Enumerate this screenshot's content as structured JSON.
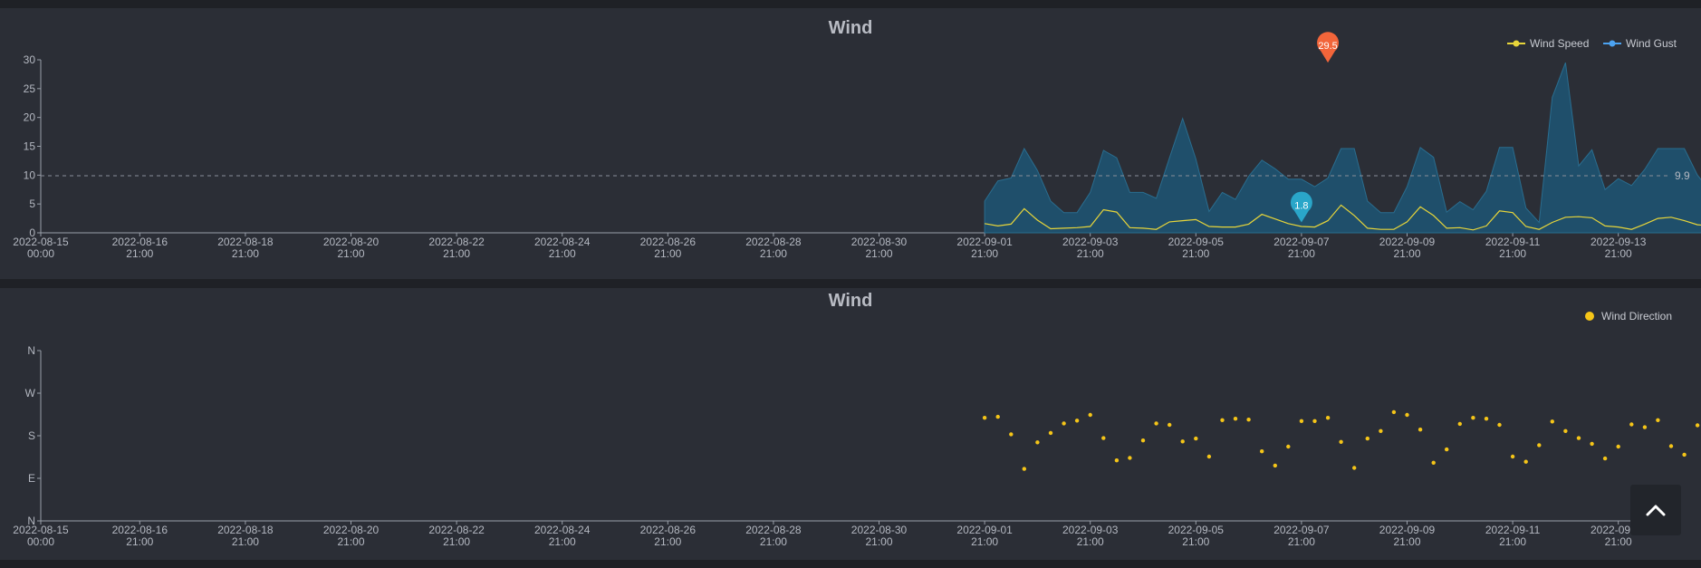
{
  "colors": {
    "panel": "#2b2e36",
    "gust_fill": "#1f4f6b",
    "speed_line": "#e7d53a",
    "direction_point": "#f5c518",
    "max_pin": "#f2653a",
    "min_pin": "#2aa6c9",
    "reference_line": "#8a8f99"
  },
  "icons": {
    "scroll_top": "chevron-up-icon"
  },
  "x_ticks": [
    {
      "line1": "2022-08-15",
      "line2": "00:00"
    },
    {
      "line1": "2022-08-16",
      "line2": "21:00"
    },
    {
      "line1": "2022-08-18",
      "line2": "21:00"
    },
    {
      "line1": "2022-08-20",
      "line2": "21:00"
    },
    {
      "line1": "2022-08-22",
      "line2": "21:00"
    },
    {
      "line1": "2022-08-24",
      "line2": "21:00"
    },
    {
      "line1": "2022-08-26",
      "line2": "21:00"
    },
    {
      "line1": "2022-08-28",
      "line2": "21:00"
    },
    {
      "line1": "2022-08-30",
      "line2": "21:00"
    },
    {
      "line1": "2022-09-01",
      "line2": "21:00"
    },
    {
      "line1": "2022-09-03",
      "line2": "21:00"
    },
    {
      "line1": "2022-09-05",
      "line2": "21:00"
    },
    {
      "line1": "2022-09-07",
      "line2": "21:00"
    },
    {
      "line1": "2022-09-09",
      "line2": "21:00"
    },
    {
      "line1": "2022-09-11",
      "line2": "21:00"
    },
    {
      "line1": "2022-09-13",
      "line2": "21:00"
    }
  ],
  "chart_data": [
    {
      "type": "area",
      "title": "Wind",
      "xlabel": "",
      "ylabel": "",
      "ylim": [
        0,
        30
      ],
      "y_ticks": [
        "0",
        "5",
        "10",
        "15",
        "20",
        "25",
        "30"
      ],
      "legend_position": "top-right",
      "grid": false,
      "x_start": "2022-08-15 00:00",
      "x_end": "2022-09-14 21:00",
      "series_x_start": "2022-09-01 21:00",
      "series_x_step_hours": 6,
      "series": [
        {
          "name": "Wind Speed",
          "style": "line",
          "values": [
            1.6,
            1.2,
            1.5,
            4.2,
            2.2,
            0.7,
            0.8,
            0.9,
            1.1,
            4,
            3.6,
            0.9,
            0.8,
            0.6,
            1.9,
            2.1,
            2.3,
            1.1,
            1,
            1,
            1.5,
            3.2,
            2.4,
            1.6,
            1.1,
            1,
            2.1,
            4.8,
            3,
            0.8,
            0.6,
            0.6,
            1.9,
            4.5,
            3,
            0.8,
            0.9,
            0.5,
            1.2,
            3.8,
            3.5,
            1.1,
            0.6,
            1.8,
            2.7,
            2.8,
            2.6,
            1.2,
            1,
            0.6,
            1.5,
            2.5,
            2.7,
            2.1,
            1.4,
            1.2,
            2,
            4,
            2.6,
            1.6,
            0.7,
            1.2,
            1.8,
            4.2,
            2.6,
            1.2,
            1.2,
            1.9,
            2.5,
            3.1,
            2.4,
            1.5,
            1.2,
            1.6,
            3.5
          ]
        },
        {
          "name": "Wind Gust",
          "style": "area",
          "values": [
            5.5,
            9,
            9.5,
            14.6,
            10.8,
            5.5,
            3.5,
            3.5,
            7,
            14.3,
            13,
            7,
            7,
            6,
            13,
            19.8,
            12.8,
            3.7,
            7,
            5.8,
            9.8,
            12.6,
            11.1,
            9.3,
            9.3,
            8,
            9.5,
            14.6,
            14.6,
            5.5,
            3.5,
            3.5,
            8,
            14.8,
            13.1,
            3.6,
            5.4,
            4,
            7.2,
            14.8,
            14.8,
            4.3,
            1.8,
            23.5,
            29.5,
            11.6,
            14.4,
            7.5,
            9.4,
            8.2,
            11,
            14.6,
            14.6,
            14.6,
            10,
            7.1,
            11,
            14.6,
            11,
            11,
            3.5,
            5.5,
            7,
            14.6,
            11,
            9,
            4,
            9,
            9.3,
            11.4,
            12.8,
            12.8,
            3.5,
            6,
            12.8
          ]
        }
      ],
      "reference_line": {
        "value": 9.9,
        "label": "9.9"
      },
      "markers": [
        {
          "label": "29.5",
          "kind": "max",
          "x": "2022-09-08 09:00",
          "y": 29.5
        },
        {
          "label": "1.8",
          "kind": "min",
          "x": "2022-09-07 21:00",
          "y": 1.8
        }
      ]
    },
    {
      "type": "scatter",
      "title": "Wind",
      "xlabel": "",
      "ylabel": "",
      "y_ticks": [
        "N",
        "E",
        "S",
        "W",
        "N"
      ],
      "ylim": [
        0,
        360
      ],
      "legend_position": "top-right",
      "grid": false,
      "x_start": "2022-08-15 00:00",
      "x_end": "2022-09-14 21:00",
      "series_x_start": "2022-09-01 21:00",
      "series_x_step_hours": 6,
      "series": [
        {
          "name": "Wind Direction",
          "values": [
            218,
            220,
            183,
            110,
            166,
            186,
            206,
            212,
            224,
            175,
            128,
            133,
            170,
            206,
            203,
            168,
            174,
            136,
            213,
            216,
            214,
            147,
            117,
            157,
            211,
            211,
            218,
            167,
            112,
            174,
            190,
            230,
            224,
            193,
            123,
            151,
            205,
            218,
            216,
            203,
            136,
            125,
            160,
            210,
            190,
            175,
            163,
            132,
            157,
            204,
            198,
            213,
            158,
            140,
            202,
            216,
            206,
            206,
            151,
            115,
            160,
            221,
            216,
            219,
            155,
            121,
            160,
            202,
            204,
            209,
            193,
            143,
            203,
            206,
            208,
            221,
            216,
            126
          ]
        }
      ]
    }
  ]
}
